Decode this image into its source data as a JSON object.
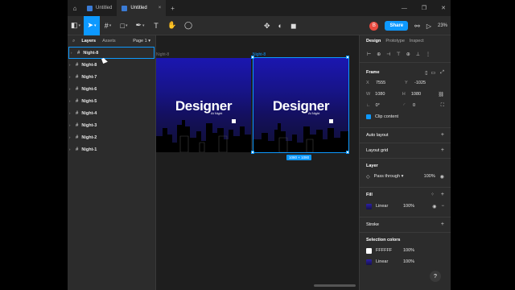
{
  "titlebar": {
    "home_icon": "home-icon",
    "tabs": [
      {
        "label": "Untitled",
        "active": false
      },
      {
        "label": "Untitled",
        "active": true
      }
    ],
    "close_glyph": "×",
    "new_tab": "+",
    "window_controls": [
      "—",
      "❐",
      "✕"
    ]
  },
  "toolbar": {
    "zoom": "23%",
    "avatar_letter": "B",
    "share_label": "Share"
  },
  "left_panel": {
    "tabs": {
      "layers": "Layers",
      "assets": "Assets",
      "page": "Page 1"
    },
    "layers": [
      {
        "name": "Night-8",
        "selected": true
      },
      {
        "name": "Night-8",
        "selected": false
      },
      {
        "name": "Night-7",
        "selected": false
      },
      {
        "name": "Night-6",
        "selected": false
      },
      {
        "name": "Night-5",
        "selected": false
      },
      {
        "name": "Night-4",
        "selected": false
      },
      {
        "name": "Night-3",
        "selected": false
      },
      {
        "name": "Night-2",
        "selected": false
      },
      {
        "name": "Night-1",
        "selected": false
      }
    ]
  },
  "canvas": {
    "frames": [
      {
        "label": "Night-8",
        "title": "Designer",
        "subtitle": "At Night",
        "selected": false
      },
      {
        "label": "Night-8",
        "title": "Designer",
        "subtitle": "At Night",
        "selected": true
      }
    ],
    "dimension_badge": "1080 × 1080",
    "colors": {
      "selection": "#0d99ff",
      "sky_top": "#1b16b0",
      "sky_bottom": "#101030"
    }
  },
  "right_panel": {
    "tabs": {
      "design": "Design",
      "prototype": "Prototype",
      "inspect": "Inspect"
    },
    "frame": {
      "title": "Frame",
      "x_label": "X",
      "x": "7555",
      "y_label": "Y",
      "y": "-1025",
      "w_label": "W",
      "w": "1080",
      "h_label": "H",
      "h": "1080",
      "rotation": "0°",
      "radius": "0",
      "clip_content": "Clip content"
    },
    "auto_layout": "Auto layout",
    "layout_grid": "Layout grid",
    "layer": {
      "title": "Layer",
      "blend": "Pass through",
      "opacity": "100%"
    },
    "fill": {
      "title": "Fill",
      "type": "Linear",
      "opacity": "100%"
    },
    "stroke": "Stroke",
    "selection_colors": {
      "title": "Selection colors",
      "items": [
        {
          "value": "FFFFFF",
          "opacity": "100%"
        },
        {
          "value": "Linear",
          "opacity": "100%"
        }
      ]
    },
    "help": "?"
  }
}
